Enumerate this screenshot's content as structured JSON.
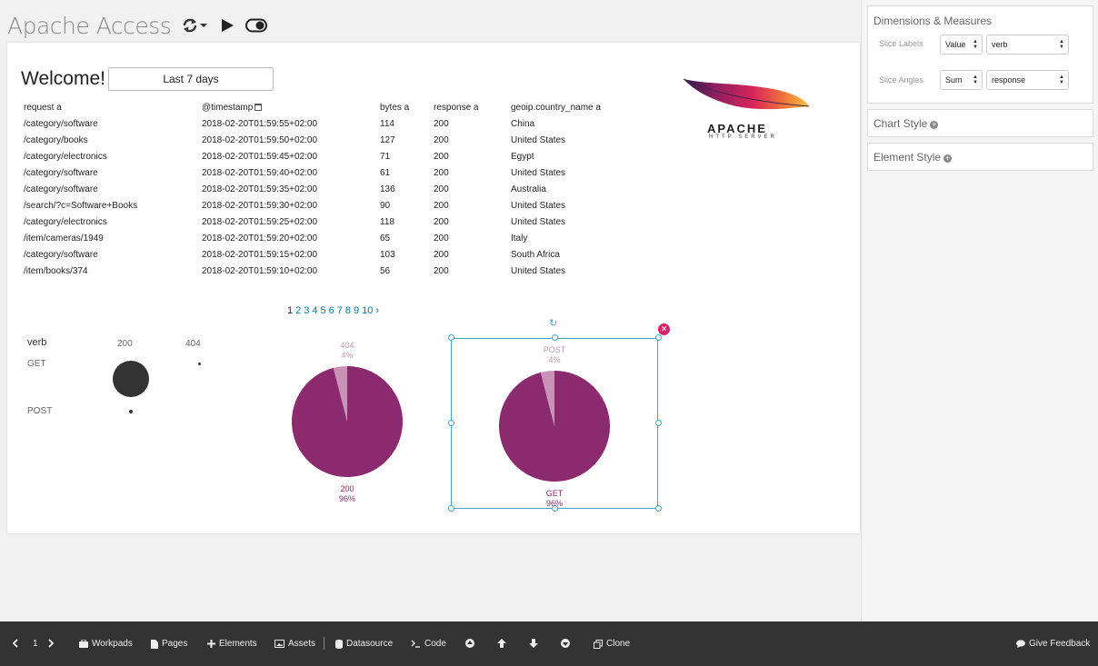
{
  "header": {
    "title": "Apache Access",
    "refresh_icon": "refresh-icon",
    "play_icon": "play-icon",
    "toggle_icon": "toggle-icon"
  },
  "workpad": {
    "welcome": "Welcome!",
    "time_filter": "Last 7 days",
    "table": {
      "columns": [
        "request a",
        "@timestamp",
        "bytes a",
        "response a",
        "geoip.country_name a"
      ],
      "rows": [
        [
          "/category/software",
          "2018-02-20T01:59:55+02:00",
          "114",
          "200",
          "China"
        ],
        [
          "/category/books",
          "2018-02-20T01:59:50+02:00",
          "127",
          "200",
          "United States"
        ],
        [
          "/category/electronics",
          "2018-02-20T01:59:45+02:00",
          "71",
          "200",
          "Egypt"
        ],
        [
          "/category/software",
          "2018-02-20T01:59:40+02:00",
          "61",
          "200",
          "United States"
        ],
        [
          "/category/software",
          "2018-02-20T01:59:35+02:00",
          "136",
          "200",
          "Australia"
        ],
        [
          "/search/?c=Software+Books",
          "2018-02-20T01:59:30+02:00",
          "90",
          "200",
          "United States"
        ],
        [
          "/category/electronics",
          "2018-02-20T01:59:25+02:00",
          "118",
          "200",
          "United States"
        ],
        [
          "/item/cameras/1949",
          "2018-02-20T01:59:20+02:00",
          "65",
          "200",
          "Italy"
        ],
        [
          "/category/software",
          "2018-02-20T01:59:15+02:00",
          "103",
          "200",
          "South Africa"
        ],
        [
          "/item/books/374",
          "2018-02-20T01:59:10+02:00",
          "56",
          "200",
          "United States"
        ]
      ]
    },
    "pagination": [
      "1",
      "2",
      "3",
      "4",
      "5",
      "6",
      "7",
      "8",
      "9",
      "10",
      "›"
    ],
    "logo": {
      "text": "APACHE",
      "subtext": "HTTP SERVER"
    },
    "dotgrid": {
      "row_header": "verb",
      "columns": [
        "200",
        "404"
      ],
      "rows": [
        "GET",
        "POST"
      ]
    }
  },
  "chart_data": [
    {
      "type": "pie",
      "labels": [
        "200",
        "404"
      ],
      "values": [
        96,
        4
      ],
      "label_text": [
        [
          "200",
          "96%"
        ],
        [
          "404",
          "4%"
        ]
      ],
      "colors": [
        "#8b2a6e",
        "#c893b6"
      ]
    },
    {
      "type": "pie",
      "labels": [
        "GET",
        "POST"
      ],
      "values": [
        96,
        4
      ],
      "label_text": [
        [
          "GET",
          "96%"
        ],
        [
          "POST",
          "4%"
        ]
      ],
      "colors": [
        "#8b2a6e",
        "#c893b6"
      ]
    }
  ],
  "sidebar": {
    "dimensions_title": "Dimensions & Measures",
    "slice_labels": {
      "label": "Slice Labels",
      "agg": "Value",
      "field": "verb"
    },
    "slice_angles": {
      "label": "Slice Angles",
      "agg": "Sum",
      "field": "response"
    },
    "chart_style": "Chart Style",
    "element_style": "Element Style"
  },
  "footer": {
    "page_number": "1",
    "workpads": "Workpads",
    "pages": "Pages",
    "elements": "Elements",
    "assets": "Assets",
    "datasource": "Datasource",
    "code": "Code",
    "clone": "Clone",
    "feedback": "Give Feedback"
  }
}
